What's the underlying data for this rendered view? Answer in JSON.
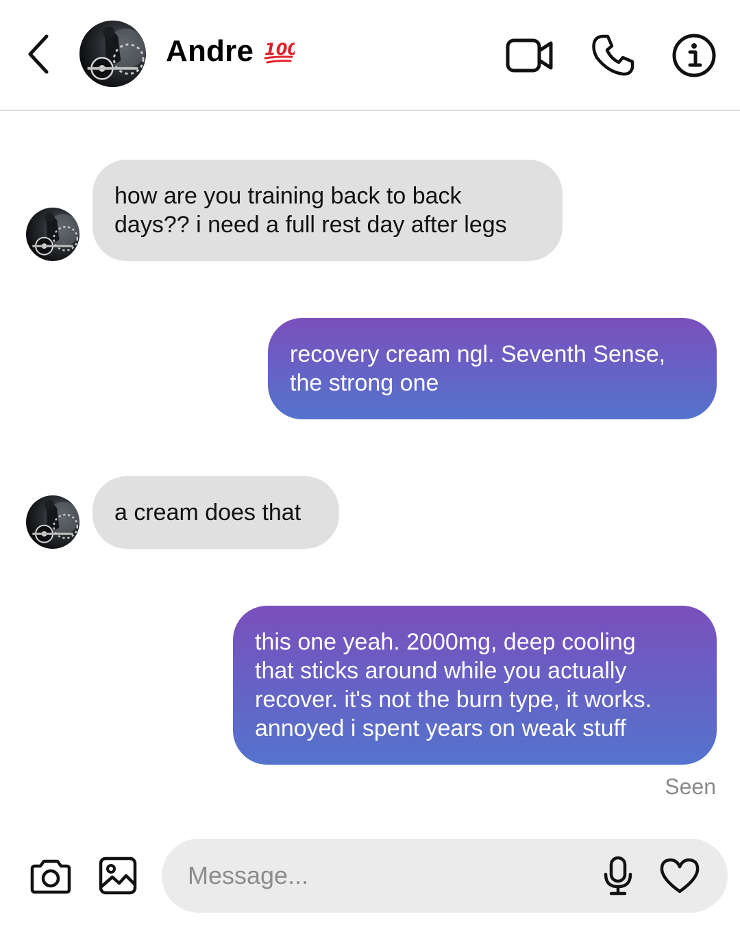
{
  "header": {
    "contact_name": "Andre",
    "name_badge": "💯",
    "back_icon": "chevron-left-icon",
    "video_icon": "video-camera-icon",
    "phone_icon": "phone-icon",
    "info_icon": "info-icon"
  },
  "messages": [
    {
      "direction": "incoming",
      "text": "how are you training back to back\ndays?? i need a full rest day after legs"
    },
    {
      "direction": "outgoing",
      "text": "recovery cream ngl. Seventh Sense,\nthe strong one"
    },
    {
      "direction": "incoming",
      "text": "a cream does that"
    },
    {
      "direction": "outgoing",
      "text": "this one yeah. 2000mg, deep cooling\nthat sticks around while you actually\nrecover. it's not the burn type, it works.\nannoyed i spent years on weak stuff"
    }
  ],
  "status": {
    "seen": "Seen"
  },
  "composer": {
    "placeholder": "Message...",
    "camera_icon": "camera-icon",
    "gallery_icon": "image-icon",
    "mic_icon": "microphone-icon",
    "heart_icon": "heart-icon"
  },
  "colors": {
    "incoming_bubble": "#e0e0e0",
    "outgoing_gradient_top": "#7b4fbd",
    "outgoing_gradient_bottom": "#5374cd",
    "badge_red": "#e0202a"
  }
}
